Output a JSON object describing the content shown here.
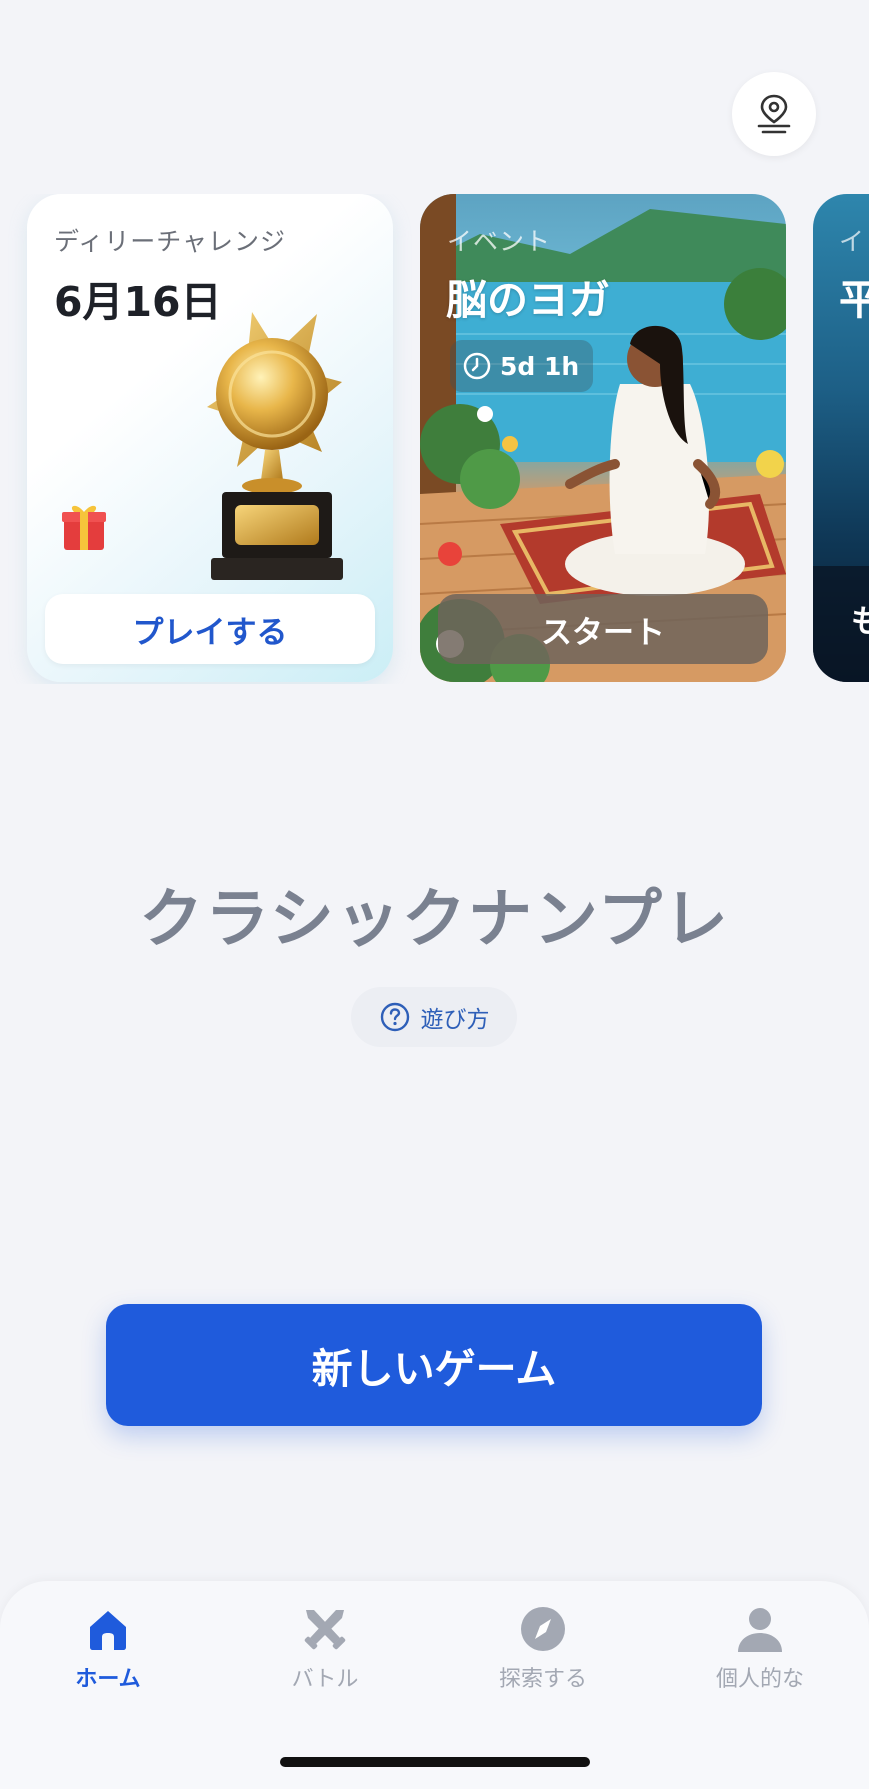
{
  "header": {
    "location_icon": "location-pin-icon"
  },
  "cards": {
    "daily": {
      "label": "ディリーチャレンジ",
      "date": "6月16日",
      "button": "プレイする",
      "icons": [
        "trophy-icon",
        "gift-icon"
      ]
    },
    "event": {
      "label": "イベント",
      "title": "脳のヨガ",
      "timer": "5d 1h",
      "button": "スタート",
      "timer_icon": "clock-icon"
    },
    "third": {
      "label": "イ",
      "title": "平",
      "button": "も"
    }
  },
  "main": {
    "title": "クラシックナンプレ",
    "howto_label": "遊び方",
    "howto_icon": "help-circle-icon",
    "new_game_label": "新しいゲーム"
  },
  "tabs": [
    {
      "label": "ホーム",
      "icon": "home-icon",
      "active": true
    },
    {
      "label": "バトル",
      "icon": "crossed-swords-icon",
      "active": false
    },
    {
      "label": "探索する",
      "icon": "compass-icon",
      "active": false
    },
    {
      "label": "個人的な",
      "icon": "person-icon",
      "active": false
    }
  ],
  "colors": {
    "accent": "#1f5bdc",
    "background": "#f3f4f8",
    "inactive": "#a3a8b3",
    "title_gray": "#7a8190"
  }
}
